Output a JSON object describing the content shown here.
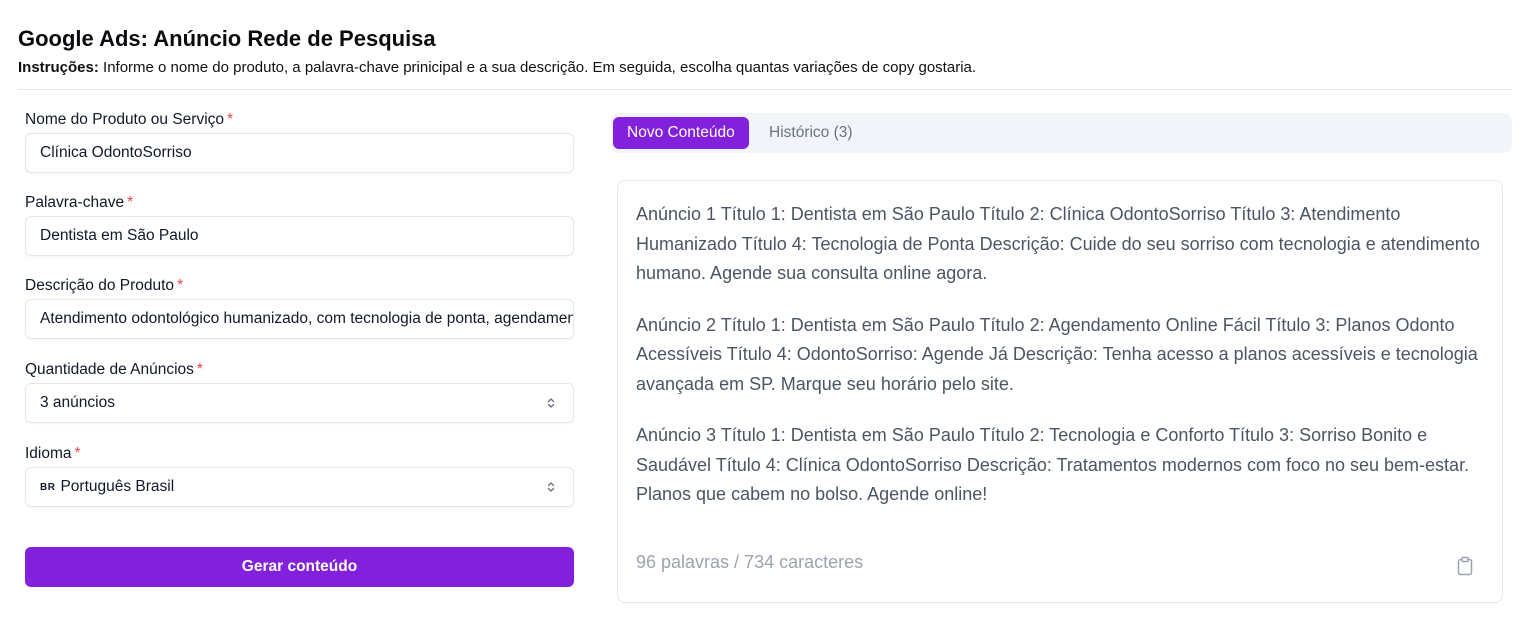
{
  "header": {
    "title": "Google Ads: Anúncio Rede de Pesquisa",
    "instructions_label": "Instruções:",
    "instructions_text": "Informe o nome do produto, a palavra-chave prinicipal e a sua descrição. Em seguida, escolha quantas variações de copy gostaria."
  },
  "form": {
    "required_mark": "*",
    "product": {
      "label": "Nome do Produto ou Serviço",
      "value": "Clínica OdontoSorriso"
    },
    "keyword": {
      "label": "Palavra-chave",
      "value": "Dentista em São Paulo"
    },
    "description": {
      "label": "Descrição do Produto",
      "value": "Atendimento odontológico humanizado, com tecnologia de ponta, agendamento online e planos acessíveis."
    },
    "quantity": {
      "label": "Quantidade de Anúncios",
      "value": "3 anúncios"
    },
    "language": {
      "label": "Idioma",
      "flag": "BR",
      "value": "Português Brasil"
    },
    "submit_label": "Gerar conteúdo"
  },
  "tabs": {
    "new_label": "Novo Conteúdo",
    "history_label": "Histórico (3)"
  },
  "output": {
    "ads": [
      "Anúncio 1 Título 1: Dentista em São Paulo Título 2: Clínica OdontoSorriso Título 3: Atendimento Humanizado Título 4: Tecnologia de Ponta Descrição: Cuide do seu sorriso com tecnologia e atendimento humano. Agende sua consulta online agora.",
      "Anúncio 2 Título 1: Dentista em São Paulo Título 2: Agendamento Online Fácil Título 3: Planos Odonto Acessíveis Título 4: OdontoSorriso: Agende Já Descrição: Tenha acesso a planos acessíveis e tecnologia avançada em SP. Marque seu horário pelo site.",
      "Anúncio 3 Título 1: Dentista em São Paulo Título 2: Tecnologia e Conforto Título 3: Sorriso Bonito e Saudável Título 4: Clínica OdontoSorriso Descrição: Tratamentos modernos com foco no seu bem-estar. Planos que cabem no bolso. Agende online!"
    ],
    "count": "96 palavras / 734 caracteres",
    "copy_icon": "clipboard-icon"
  },
  "colors": {
    "accent": "#8220db",
    "required": "#ef4444",
    "muted_text": "#4b5563"
  }
}
